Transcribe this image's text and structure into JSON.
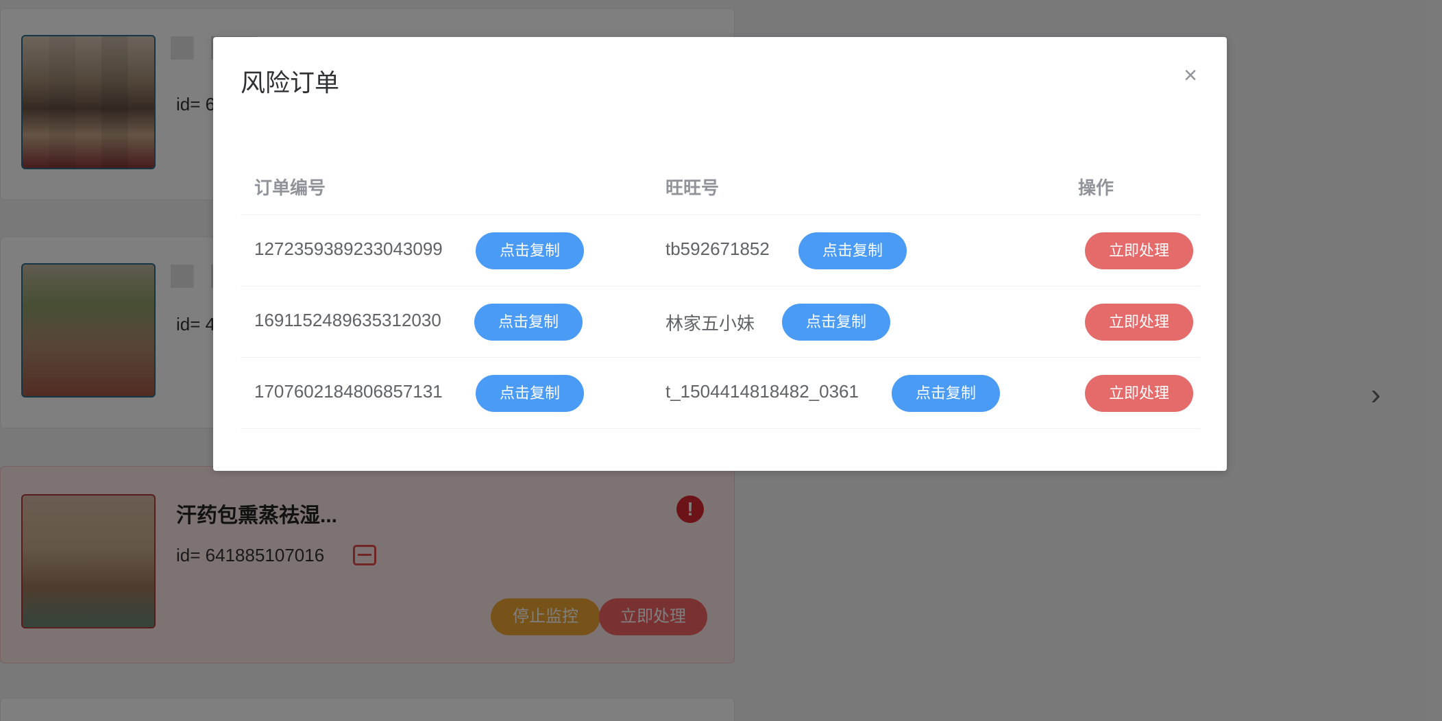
{
  "background": {
    "items": [
      {
        "id_text": "id= 6"
      },
      {
        "id_text": "id= 4"
      },
      {
        "title": "汗药包熏蒸祛湿...",
        "id_text": "id= 641885107016",
        "stop_label": "停止监控",
        "handle_label": "立即处理"
      }
    ]
  },
  "modal": {
    "title": "风险订单",
    "close_icon": "×",
    "columns": {
      "order_no": "订单编号",
      "wangwang": "旺旺号",
      "action": "操作"
    },
    "rows": [
      {
        "order_no": "1272359389233043099",
        "wangwang": "tb592671852",
        "copy_label": "点击复制",
        "handle_label": "立即处理"
      },
      {
        "order_no": "1691152489635312030",
        "wangwang": "林家五小妹",
        "copy_label": "点击复制",
        "handle_label": "立即处理"
      },
      {
        "order_no": "1707602184806857131",
        "wangwang": "t_1504414818482_0361",
        "copy_label": "点击复制",
        "handle_label": "立即处理"
      }
    ]
  },
  "icons": {
    "next": "›",
    "warning": "!"
  },
  "colors": {
    "copy_button": "#4a9bf5",
    "handle_button": "#e56b6b",
    "stop_button": "#f0a733",
    "overlay": "rgba(0,0,0,0.5)"
  }
}
